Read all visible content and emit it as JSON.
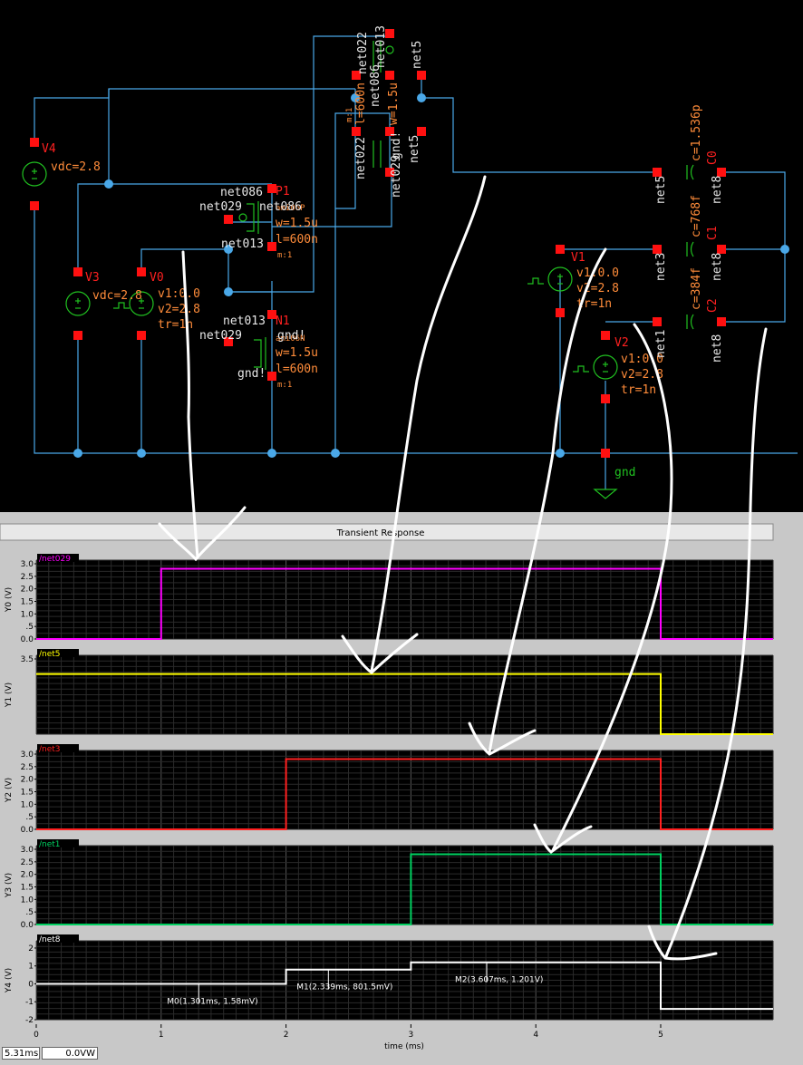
{
  "schematic": {
    "components": [
      {
        "ref": "V4",
        "params": [
          "vdc=2.8"
        ]
      },
      {
        "ref": "V3",
        "params": [
          "vdc=2.8"
        ]
      },
      {
        "ref": "V0",
        "params": [
          "v1:0.0",
          "v2=2.8",
          "tr=1n"
        ]
      },
      {
        "ref": "V1",
        "params": [
          "v1:0.0",
          "v2=2.8",
          "tr=1n"
        ]
      },
      {
        "ref": "V2",
        "params": [
          "v1:0.0",
          "v2=2.8",
          "tr=1n"
        ]
      },
      {
        "ref": "P1",
        "params": [
          "ami06P",
          "w=1.5u",
          "l=600n",
          "m:1"
        ]
      },
      {
        "ref": "N1",
        "params": [
          "ami06N",
          "w=1.5u",
          "l=600n",
          "m:1"
        ]
      },
      {
        "ref": "C0",
        "params": [
          "c=1.536p"
        ]
      },
      {
        "ref": "C1",
        "params": [
          "c=768f"
        ]
      },
      {
        "ref": "C2",
        "params": [
          "c=384f"
        ]
      }
    ],
    "nets": [
      "net086",
      "net029",
      "net013",
      "gnd!",
      "net022",
      "net5",
      "net3",
      "net1",
      "net8",
      "gnd"
    ],
    "top_cluster_labels": [
      "net013",
      "net022",
      "net086",
      "net5",
      "m:1",
      "l=600n",
      "w=1.5u",
      "gnd!",
      "net022",
      "net029",
      "net5"
    ]
  },
  "simulator": {
    "title": "Transient Response",
    "x_axis_label": "time (ms)",
    "x_ticks": [
      "0",
      "1",
      "2",
      "3",
      "4",
      "5"
    ],
    "cursor_time": "5.31ms",
    "cursor_value": "0.0VW",
    "markers": [
      {
        "label": "M0(1.301ms, 1.58mV)"
      },
      {
        "label": "M1(2.339ms, 801.5mV)"
      },
      {
        "label": "M2(3.607ms, 1.201V)"
      }
    ]
  },
  "chart_data": {
    "type": "line",
    "title": "Transient Response",
    "xlabel": "time (ms)",
    "xlim": [
      0,
      5.9
    ],
    "panels": [
      {
        "name": "/net029",
        "ylabel": "Y0 (V)",
        "color": "#ff00ff",
        "ylim": [
          0,
          3.0
        ],
        "yticks": [
          "3.0",
          "2.5",
          "2.0",
          "1.5",
          "1.0",
          ".5",
          "0.0"
        ],
        "x": [
          0,
          1,
          1,
          5,
          5,
          5.9
        ],
        "y": [
          0,
          0,
          2.8,
          2.8,
          0,
          0
        ]
      },
      {
        "name": "/net5",
        "ylabel": "Y1 (V)",
        "color": "#ffff00",
        "ylim": [
          0,
          3.5
        ],
        "yticks": [
          "3.5"
        ],
        "x": [
          0,
          5,
          5,
          5.9
        ],
        "y": [
          2.8,
          2.8,
          0,
          0
        ]
      },
      {
        "name": "/net3",
        "ylabel": "Y2 (V)",
        "color": "#ff2020",
        "ylim": [
          0,
          3.0
        ],
        "yticks": [
          "3.0",
          "2.5",
          "2.0",
          "1.5",
          "1.0",
          ".5",
          "0.0"
        ],
        "x": [
          0,
          2,
          2,
          5,
          5,
          5.9
        ],
        "y": [
          0,
          0,
          2.8,
          2.8,
          0,
          0
        ]
      },
      {
        "name": "/net1",
        "ylabel": "Y3 (V)",
        "color": "#00d060",
        "ylim": [
          0,
          3.0
        ],
        "yticks": [
          "3.0",
          "2.5",
          "2.0",
          "1.5",
          "1.0",
          ".5",
          "0.0"
        ],
        "x": [
          0,
          3,
          3,
          5,
          5,
          5.9
        ],
        "y": [
          0,
          0,
          2.8,
          2.8,
          0,
          0
        ]
      },
      {
        "name": "/net8",
        "ylabel": "Y4 (V)",
        "color": "#ffffff",
        "ylim": [
          -2.0,
          2.2
        ],
        "yticks": [
          "2",
          "1",
          "0",
          "-1",
          "-2"
        ],
        "x": [
          0,
          2,
          2,
          3,
          3,
          5,
          5,
          5.9
        ],
        "y": [
          0,
          0,
          0.8,
          0.8,
          1.2,
          1.2,
          -1.4,
          -1.4
        ]
      }
    ]
  }
}
